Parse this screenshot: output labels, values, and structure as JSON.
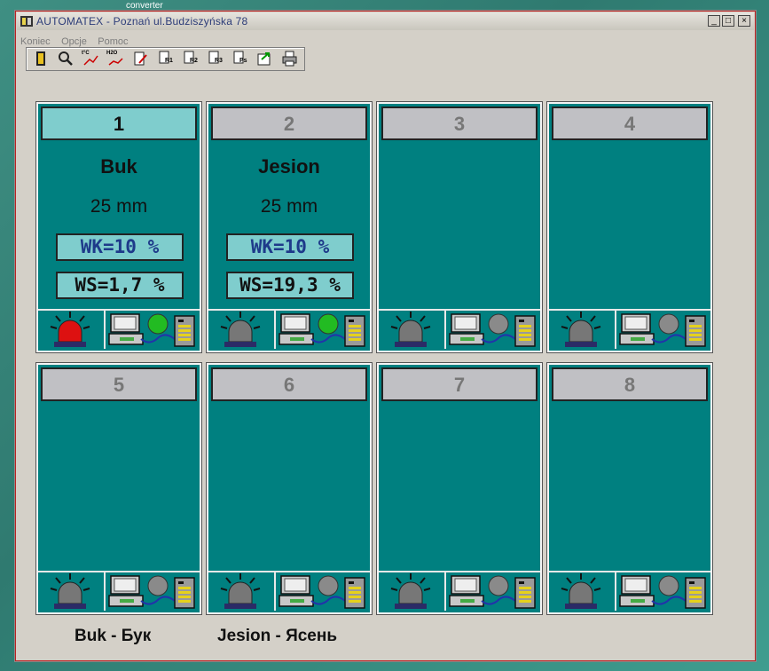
{
  "desktop": {
    "caption": "converter"
  },
  "window": {
    "title": "AUTOMATEX -  Poznań ul.Budziszyńska 78",
    "buttons": [
      "_",
      "□",
      "×"
    ]
  },
  "menu": [
    {
      "label": "Koniec"
    },
    {
      "label": "Opcje"
    },
    {
      "label": "Pomoc"
    }
  ],
  "toolbar": [
    {
      "icon": "exit-door-icon",
      "label": ""
    },
    {
      "icon": "magnifier-icon",
      "label": ""
    },
    {
      "icon": "temperature-chart-icon",
      "label": "t°C"
    },
    {
      "icon": "moisture-chart-icon",
      "label": "H2O"
    },
    {
      "icon": "edit-document-icon",
      "label": ""
    },
    {
      "icon": "report-1-icon",
      "label": "R1"
    },
    {
      "icon": "report-2-icon",
      "label": "R2"
    },
    {
      "icon": "report-3-icon",
      "label": "R3"
    },
    {
      "icon": "report-ps-icon",
      "label": "Ps"
    },
    {
      "icon": "export-icon",
      "label": ""
    },
    {
      "icon": "printer-icon",
      "label": ""
    }
  ],
  "chambers": [
    {
      "number": "1",
      "active": true,
      "species": "Buk",
      "thickness": "25 mm",
      "wk": "WK=10 %",
      "ws": "WS=1,7 %",
      "alarm": "on",
      "status_light": "green"
    },
    {
      "number": "2",
      "active": false,
      "species": "Jesion",
      "thickness": "25 mm",
      "wk": "WK=10 %",
      "ws": "WS=19,3 %",
      "alarm": "off",
      "status_light": "green"
    },
    {
      "number": "3",
      "active": false,
      "alarm": "off",
      "status_light": "gray"
    },
    {
      "number": "4",
      "active": false,
      "alarm": "off",
      "status_light": "gray"
    },
    {
      "number": "5",
      "active": false,
      "alarm": "off",
      "status_light": "gray"
    },
    {
      "number": "6",
      "active": false,
      "alarm": "off",
      "status_light": "gray"
    },
    {
      "number": "7",
      "active": false,
      "alarm": "off",
      "status_light": "gray"
    },
    {
      "number": "8",
      "active": false,
      "alarm": "off",
      "status_light": "gray"
    }
  ],
  "legend": [
    {
      "text": "Buk  -  Бук"
    },
    {
      "text": "Jesion  -  Ясень"
    }
  ],
  "colors": {
    "panel_bg": "#008080",
    "active_header": "#7fcdcd",
    "inactive_header": "#c0c0c4",
    "alarm_on": "#dd1111",
    "alarm_off": "#777777",
    "light_green": "#22bb22",
    "light_gray": "#8a8a8a"
  }
}
